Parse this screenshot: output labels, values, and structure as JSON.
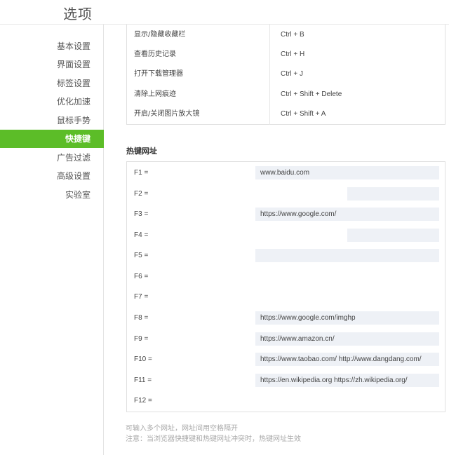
{
  "page": {
    "title": "选项"
  },
  "sidebar": {
    "items": [
      {
        "label": "基本设置",
        "active": false
      },
      {
        "label": "界面设置",
        "active": false
      },
      {
        "label": "标签设置",
        "active": false
      },
      {
        "label": "优化加速",
        "active": false
      },
      {
        "label": "鼠标手势",
        "active": false
      },
      {
        "label": "快捷键",
        "active": true
      },
      {
        "label": "广告过滤",
        "active": false
      },
      {
        "label": "高级设置",
        "active": false
      },
      {
        "label": "实验室",
        "active": false
      }
    ]
  },
  "shortcuts": {
    "rows": [
      {
        "name": "显示/隐藏收藏栏",
        "key": "Ctrl + B"
      },
      {
        "name": "查看历史记录",
        "key": "Ctrl + H"
      },
      {
        "name": "打开下载管理器",
        "key": "Ctrl + J"
      },
      {
        "name": "清除上网痕迹",
        "key": "Ctrl + Shift + Delete"
      },
      {
        "name": "开启/关闭图片放大镜",
        "key": "Ctrl + Shift + A"
      }
    ]
  },
  "hotkeys": {
    "title": "热键网址",
    "rows": [
      {
        "label": "F1 =",
        "value": "www.baidu.com"
      },
      {
        "label": "F2 =",
        "value": ""
      },
      {
        "label": "F3 =",
        "value": "https://www.google.com/"
      },
      {
        "label": "F4 =",
        "value": ""
      },
      {
        "label": "F5 =",
        "value": ""
      },
      {
        "label": "F6 =",
        "value": ""
      },
      {
        "label": "F7 =",
        "value": ""
      },
      {
        "label": "F8 =",
        "value": "https://www.google.com/imghp"
      },
      {
        "label": "F9 =",
        "value": "https://www.amazon.cn/"
      },
      {
        "label": "F10 =",
        "value": "https://www.taobao.com/ http://www.dangdang.com/"
      },
      {
        "label": "F11 =",
        "value": "https://en.wikipedia.org https://zh.wikipedia.org/"
      },
      {
        "label": "F12 =",
        "value": ""
      }
    ]
  },
  "notes": {
    "line1": "可输入多个网址，网址间用空格隔开",
    "line2": "注意：当浏览器快捷键和热键网址冲突时，热键网址生效"
  },
  "colors": {
    "accent": "#5cbd28",
    "input_bg": "#eef1f6"
  }
}
